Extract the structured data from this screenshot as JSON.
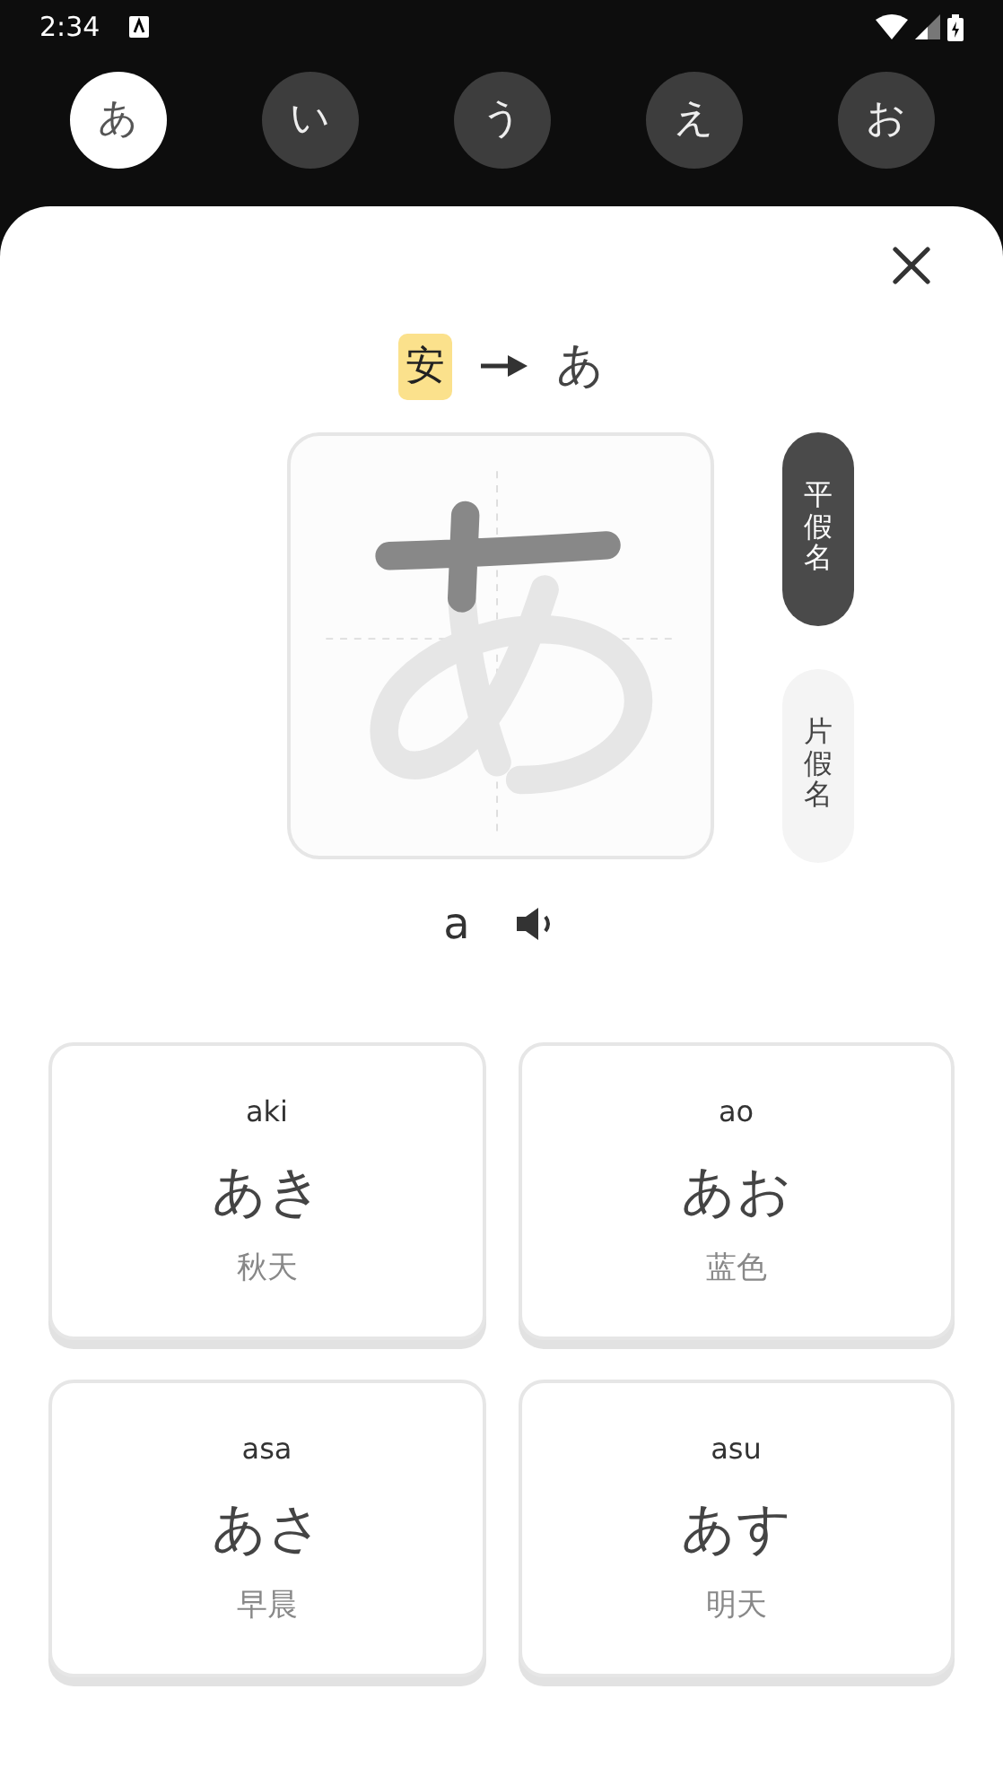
{
  "status_bar": {
    "time": "2:34"
  },
  "kana_tabs": [
    {
      "label": "あ",
      "selected": true
    },
    {
      "label": "い",
      "selected": false
    },
    {
      "label": "う",
      "selected": false
    },
    {
      "label": "え",
      "selected": false
    },
    {
      "label": "お",
      "selected": false
    }
  ],
  "origin": {
    "kanji": "安",
    "kana": "あ"
  },
  "script_toggle": [
    {
      "label": "平假名",
      "selected": true
    },
    {
      "label": "片假名",
      "selected": false
    }
  ],
  "romaji": "a",
  "words": [
    {
      "romaji": "aki",
      "kana": "あき",
      "meaning": "秋天"
    },
    {
      "romaji": "ao",
      "kana": "あお",
      "meaning": "蓝色"
    },
    {
      "romaji": "asa",
      "kana": "あさ",
      "meaning": "早晨"
    },
    {
      "romaji": "asu",
      "kana": "あす",
      "meaning": "明天"
    }
  ]
}
